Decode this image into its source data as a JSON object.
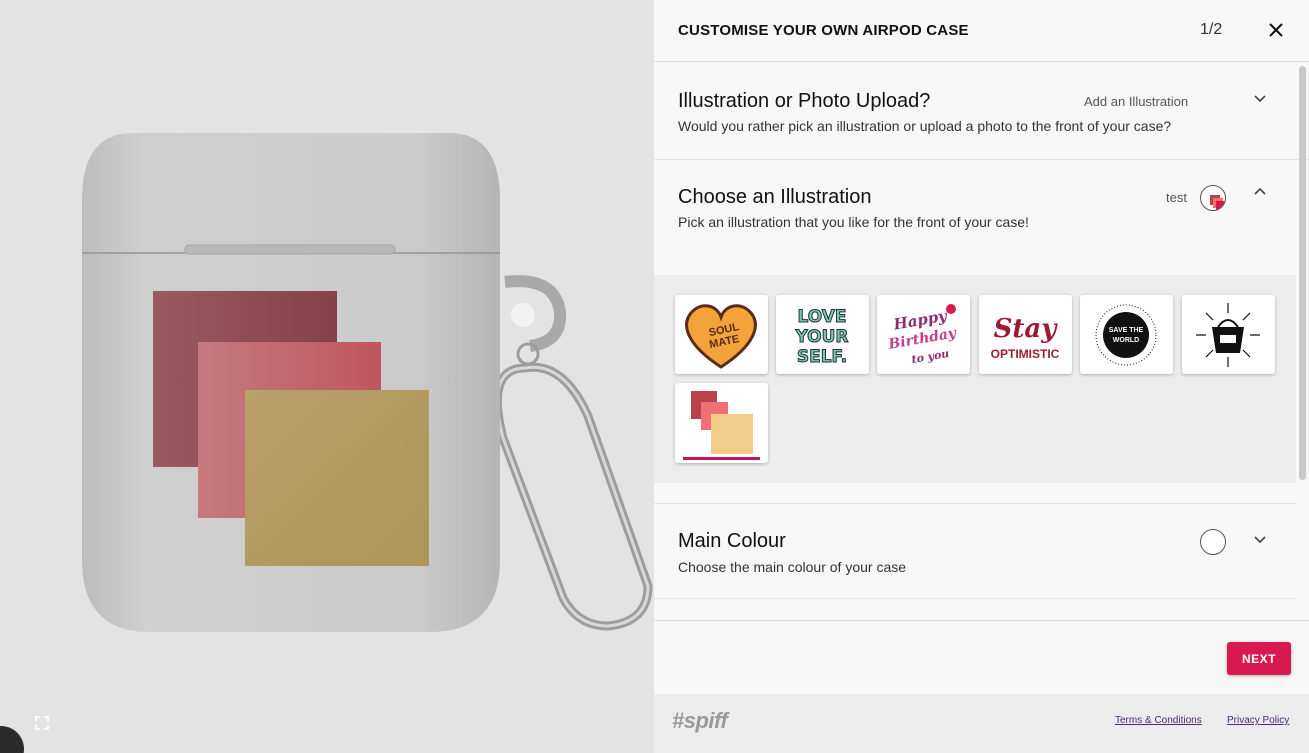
{
  "header": {
    "title": "CUSTOMISE YOUR OWN AIRPOD CASE",
    "step": "1/2"
  },
  "sections": {
    "illustration_or_photo": {
      "title": "Illustration or Photo Upload?",
      "description": "Would you rather pick an illustration or upload a photo to the front of your case?",
      "value": "Add an Illustration"
    },
    "choose_illustration": {
      "title": "Choose an Illustration",
      "description": "Pick an illustration that you like for the front of your case!",
      "value": "test",
      "options": [
        {
          "name": "soul-mate",
          "text": "SOUL MATE"
        },
        {
          "name": "love-yourself",
          "text": "LOVE YOUR SELF."
        },
        {
          "name": "happy-birthday",
          "text": "Happy Birthday to you"
        },
        {
          "name": "stay-optimistic",
          "text": "Stay OPTIMISTIC"
        },
        {
          "name": "save-the-world",
          "text": "SAVE THE WORLD"
        },
        {
          "name": "basket-icon",
          "text": ""
        },
        {
          "name": "test",
          "text": ""
        }
      ],
      "selected": "test"
    },
    "main_colour": {
      "title": "Main Colour",
      "description": "Choose the main colour of your case"
    }
  },
  "actions": {
    "next_label": "NEXT"
  },
  "footer": {
    "brand": "#spiff",
    "terms": "Terms & Conditions",
    "privacy": "Privacy Policy"
  },
  "colors": {
    "accent": "#d8194f",
    "selected_underline": "#c2185b",
    "square_dark": "#8e4b52",
    "square_pink": "#c96c72",
    "square_gold": "#b3995f"
  }
}
